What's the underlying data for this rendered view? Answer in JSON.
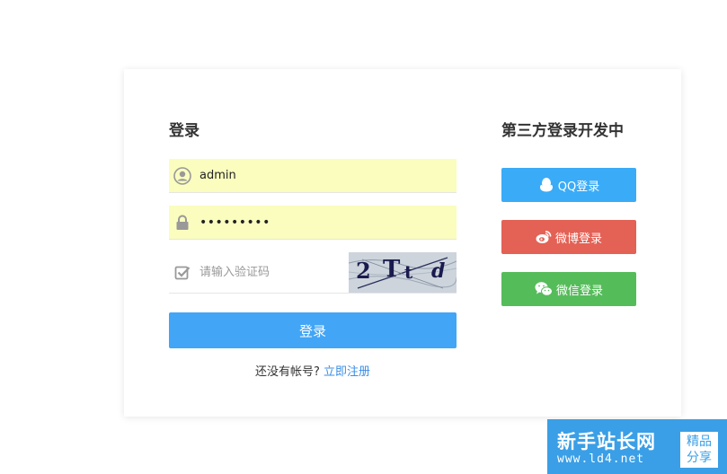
{
  "login": {
    "title": "登录",
    "username_value": "admin",
    "password_value": "•••••••••",
    "captcha_placeholder": "请输入验证码",
    "captcha_chars": [
      "2",
      "T",
      "t",
      "d"
    ],
    "submit_label": "登录",
    "register_prompt": "还没有帐号?",
    "register_link": "立即注册"
  },
  "third_party": {
    "title": "第三方登录开发中",
    "buttons": [
      {
        "label": "QQ登录",
        "color": "#3aabf7",
        "icon": "qq-icon"
      },
      {
        "label": "微博登录",
        "color": "#e46155",
        "icon": "weibo-icon"
      },
      {
        "label": "微信登录",
        "color": "#55bc5a",
        "icon": "wechat-icon"
      }
    ]
  },
  "watermark": {
    "title": "新手站长网",
    "url": "www.ld4.net",
    "badge_line1": "精品",
    "badge_line2": "分享"
  },
  "colors": {
    "primary": "#42a5f6",
    "autofill": "#fafdbe",
    "link": "#3a8ee6"
  }
}
